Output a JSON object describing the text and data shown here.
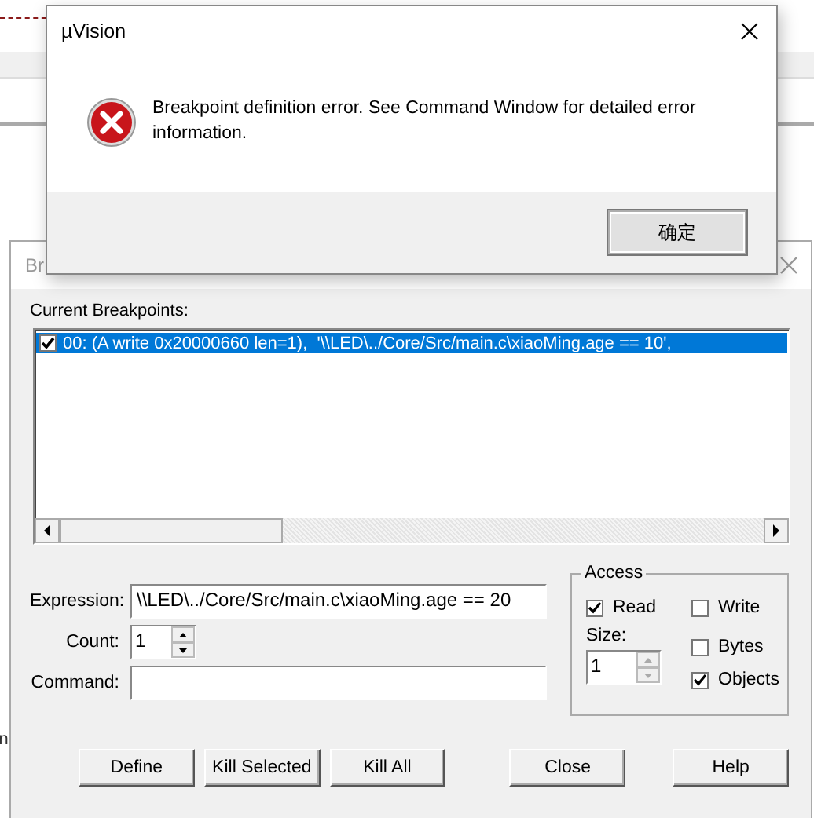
{
  "background": {
    "code_fragment": "n"
  },
  "breakpoints_dialog": {
    "title": "Br",
    "current_label": "Current Breakpoints:",
    "breakpoints": [
      {
        "text": "00: (A write 0x20000660 len=1),  '\\\\LED\\../Core/Src/main.c\\xiaoMing.age == 10',",
        "checked": true,
        "selected": true
      }
    ],
    "expression": {
      "label": "Expression:",
      "value": "\\\\LED\\../Core/Src/main.c\\xiaoMing.age == 20"
    },
    "count": {
      "label": "Count:",
      "value": "1"
    },
    "command": {
      "label": "Command:"
    },
    "access": {
      "title": "Access",
      "read": {
        "label": "Read",
        "checked": true
      },
      "write": {
        "label": "Write",
        "checked": false
      },
      "size": {
        "label": "Size:",
        "value": "1"
      },
      "bytes": {
        "label": "Bytes",
        "checked": false
      },
      "objects": {
        "label": "Objects",
        "checked": true
      }
    },
    "buttons": [
      "Define",
      "Kill Selected",
      "Kill All",
      "Close",
      "Help"
    ]
  },
  "message_box": {
    "title": "µVision",
    "message": "Breakpoint definition error. See Command Window for detailed error information.",
    "buttons": [
      "确定"
    ]
  }
}
